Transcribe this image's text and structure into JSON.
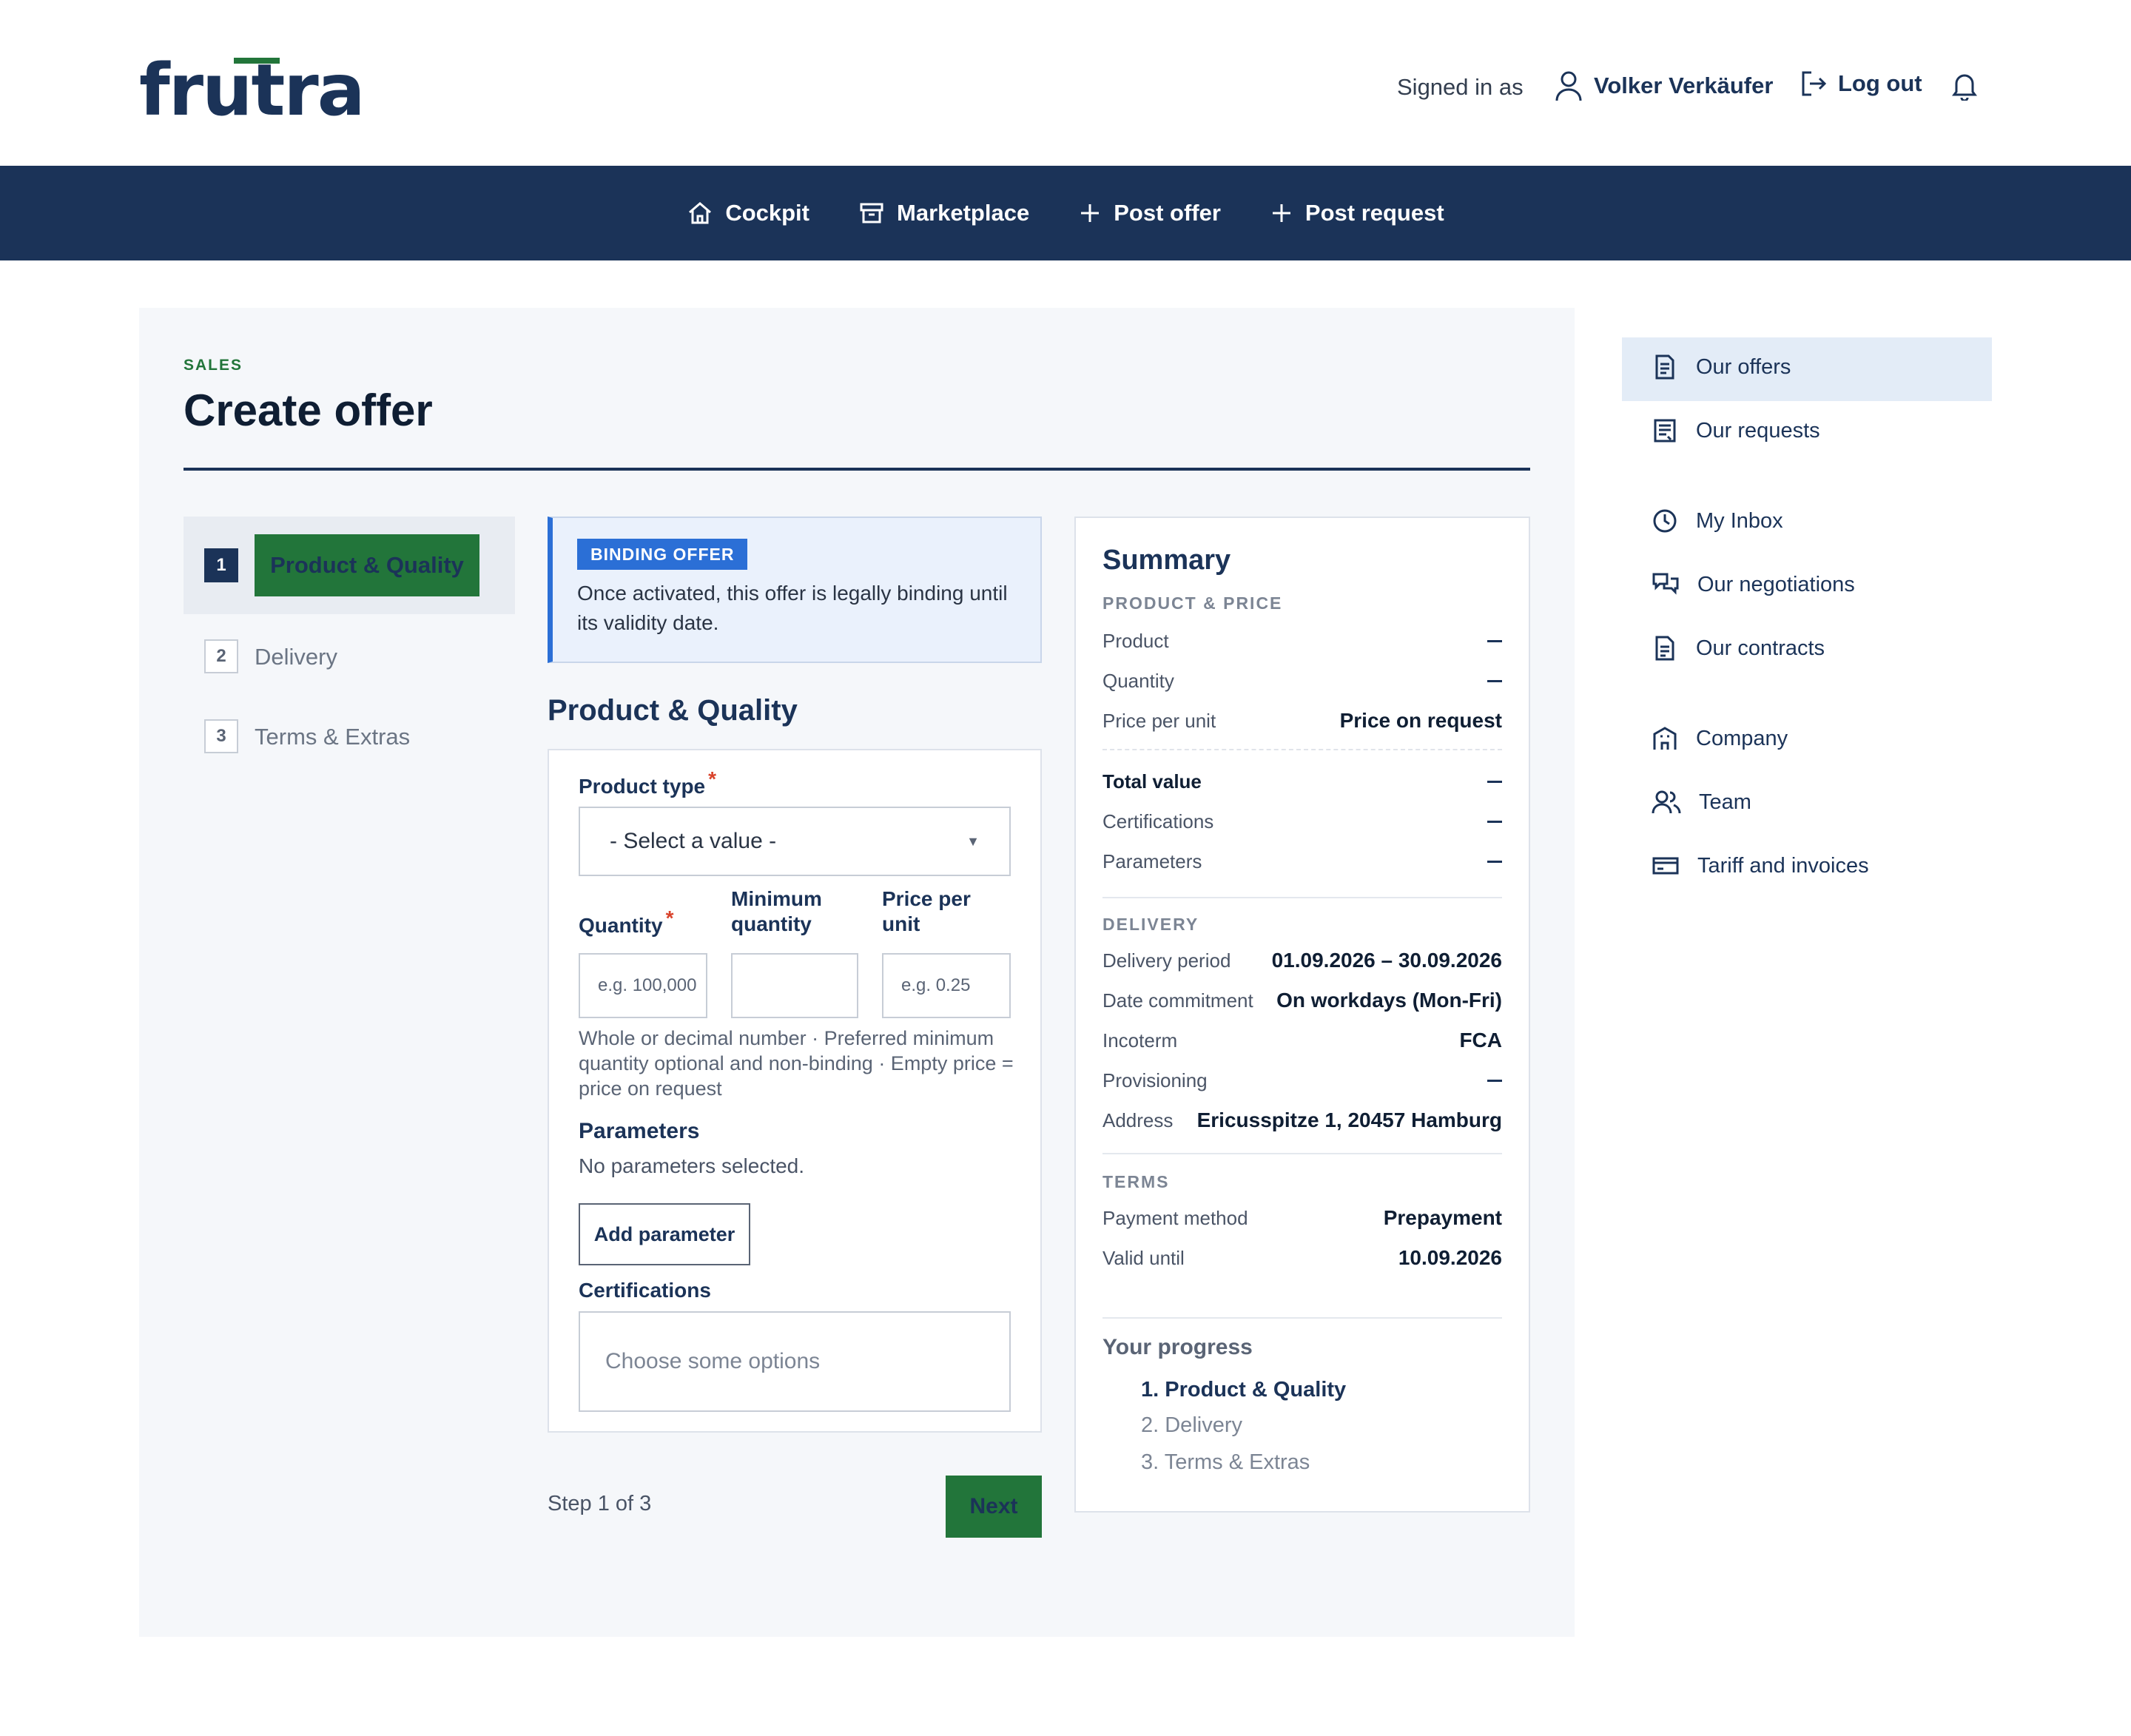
{
  "header": {
    "logo": "frutra",
    "signed_in_label": "Signed in as",
    "user_name": "Volker Verkäufer",
    "logout_label": "Log out"
  },
  "nav": {
    "items": [
      {
        "label": "Cockpit",
        "icon": "home-icon"
      },
      {
        "label": "Marketplace",
        "icon": "archive-box-icon"
      },
      {
        "label": "Post offer",
        "icon": "plus-icon"
      },
      {
        "label": "Post request",
        "icon": "plus-icon"
      }
    ]
  },
  "page": {
    "eyebrow": "SALES",
    "title": "Create offer"
  },
  "steps": [
    {
      "num": "1",
      "label": "Product & Quality"
    },
    {
      "num": "2",
      "label": "Delivery"
    },
    {
      "num": "3",
      "label": "Terms & Extras"
    }
  ],
  "callout": {
    "badge": "BINDING OFFER",
    "text": "Once activated, this offer is legally binding until its validity date."
  },
  "form": {
    "section_title": "Product & Quality",
    "product_type_label": "Product type",
    "product_type_value": "- Select a value -",
    "quantity_label": "Quantity",
    "quantity_placeholder": "e.g. 100,000",
    "min_quantity_label": "Minimum quantity",
    "min_quantity_value": "",
    "price_label": "Price per unit",
    "price_placeholder": "e.g. 0.25",
    "hint": "Whole or decimal number · Preferred minimum quantity optional and non-binding · Empty price = price on request",
    "parameters_label": "Parameters",
    "parameters_empty": "No parameters selected.",
    "add_parameter": "Add parameter",
    "certifications_label": "Certifications",
    "certifications_placeholder": "Choose some options",
    "step_of": "Step 1 of 3",
    "next": "Next"
  },
  "summary": {
    "title": "Summary",
    "product_price_heading": "PRODUCT & PRICE",
    "product_label": "Product",
    "quantity_label": "Quantity",
    "price_label": "Price per unit",
    "price_value": "Price on request",
    "total_label": "Total value",
    "certifications_label": "Certifications",
    "parameters_label": "Parameters",
    "delivery_heading": "DELIVERY",
    "delivery_period_label": "Delivery period",
    "delivery_period_value": "01.09.2026 – 30.09.2026",
    "date_commitment_label": "Date commitment",
    "date_commitment_value": "On workdays (Mon-Fri)",
    "incoterm_label": "Incoterm",
    "incoterm_value": "FCA",
    "provisioning_label": "Provisioning",
    "address_label": "Address",
    "address_value": "Ericusspitze 1, 20457 Hamburg",
    "terms_heading": "TERMS",
    "payment_label": "Payment method",
    "payment_value": "Prepayment",
    "valid_label": "Valid until",
    "valid_value": "10.09.2026",
    "progress_heading": "Your progress",
    "progress": [
      "1. Product & Quality",
      "2. Delivery",
      "3. Terms & Extras"
    ]
  },
  "sidebar": {
    "items": [
      {
        "label": "Our offers",
        "icon": "document-icon"
      },
      {
        "label": "Our requests",
        "icon": "list-document-icon"
      },
      {
        "label": "My Inbox",
        "icon": "clock-icon"
      },
      {
        "label": "Our negotiations",
        "icon": "chat-bubbles-icon"
      },
      {
        "label": "Our contracts",
        "icon": "contract-icon"
      },
      {
        "label": "Company",
        "icon": "building-icon"
      },
      {
        "label": "Team",
        "icon": "users-icon"
      },
      {
        "label": "Tariff and invoices",
        "icon": "credit-card-icon"
      }
    ]
  },
  "colors": {
    "brand_navy": "#1b3358",
    "brand_green": "#22753a",
    "accent_blue": "#2b6fd6",
    "required_red": "#d9432b"
  }
}
